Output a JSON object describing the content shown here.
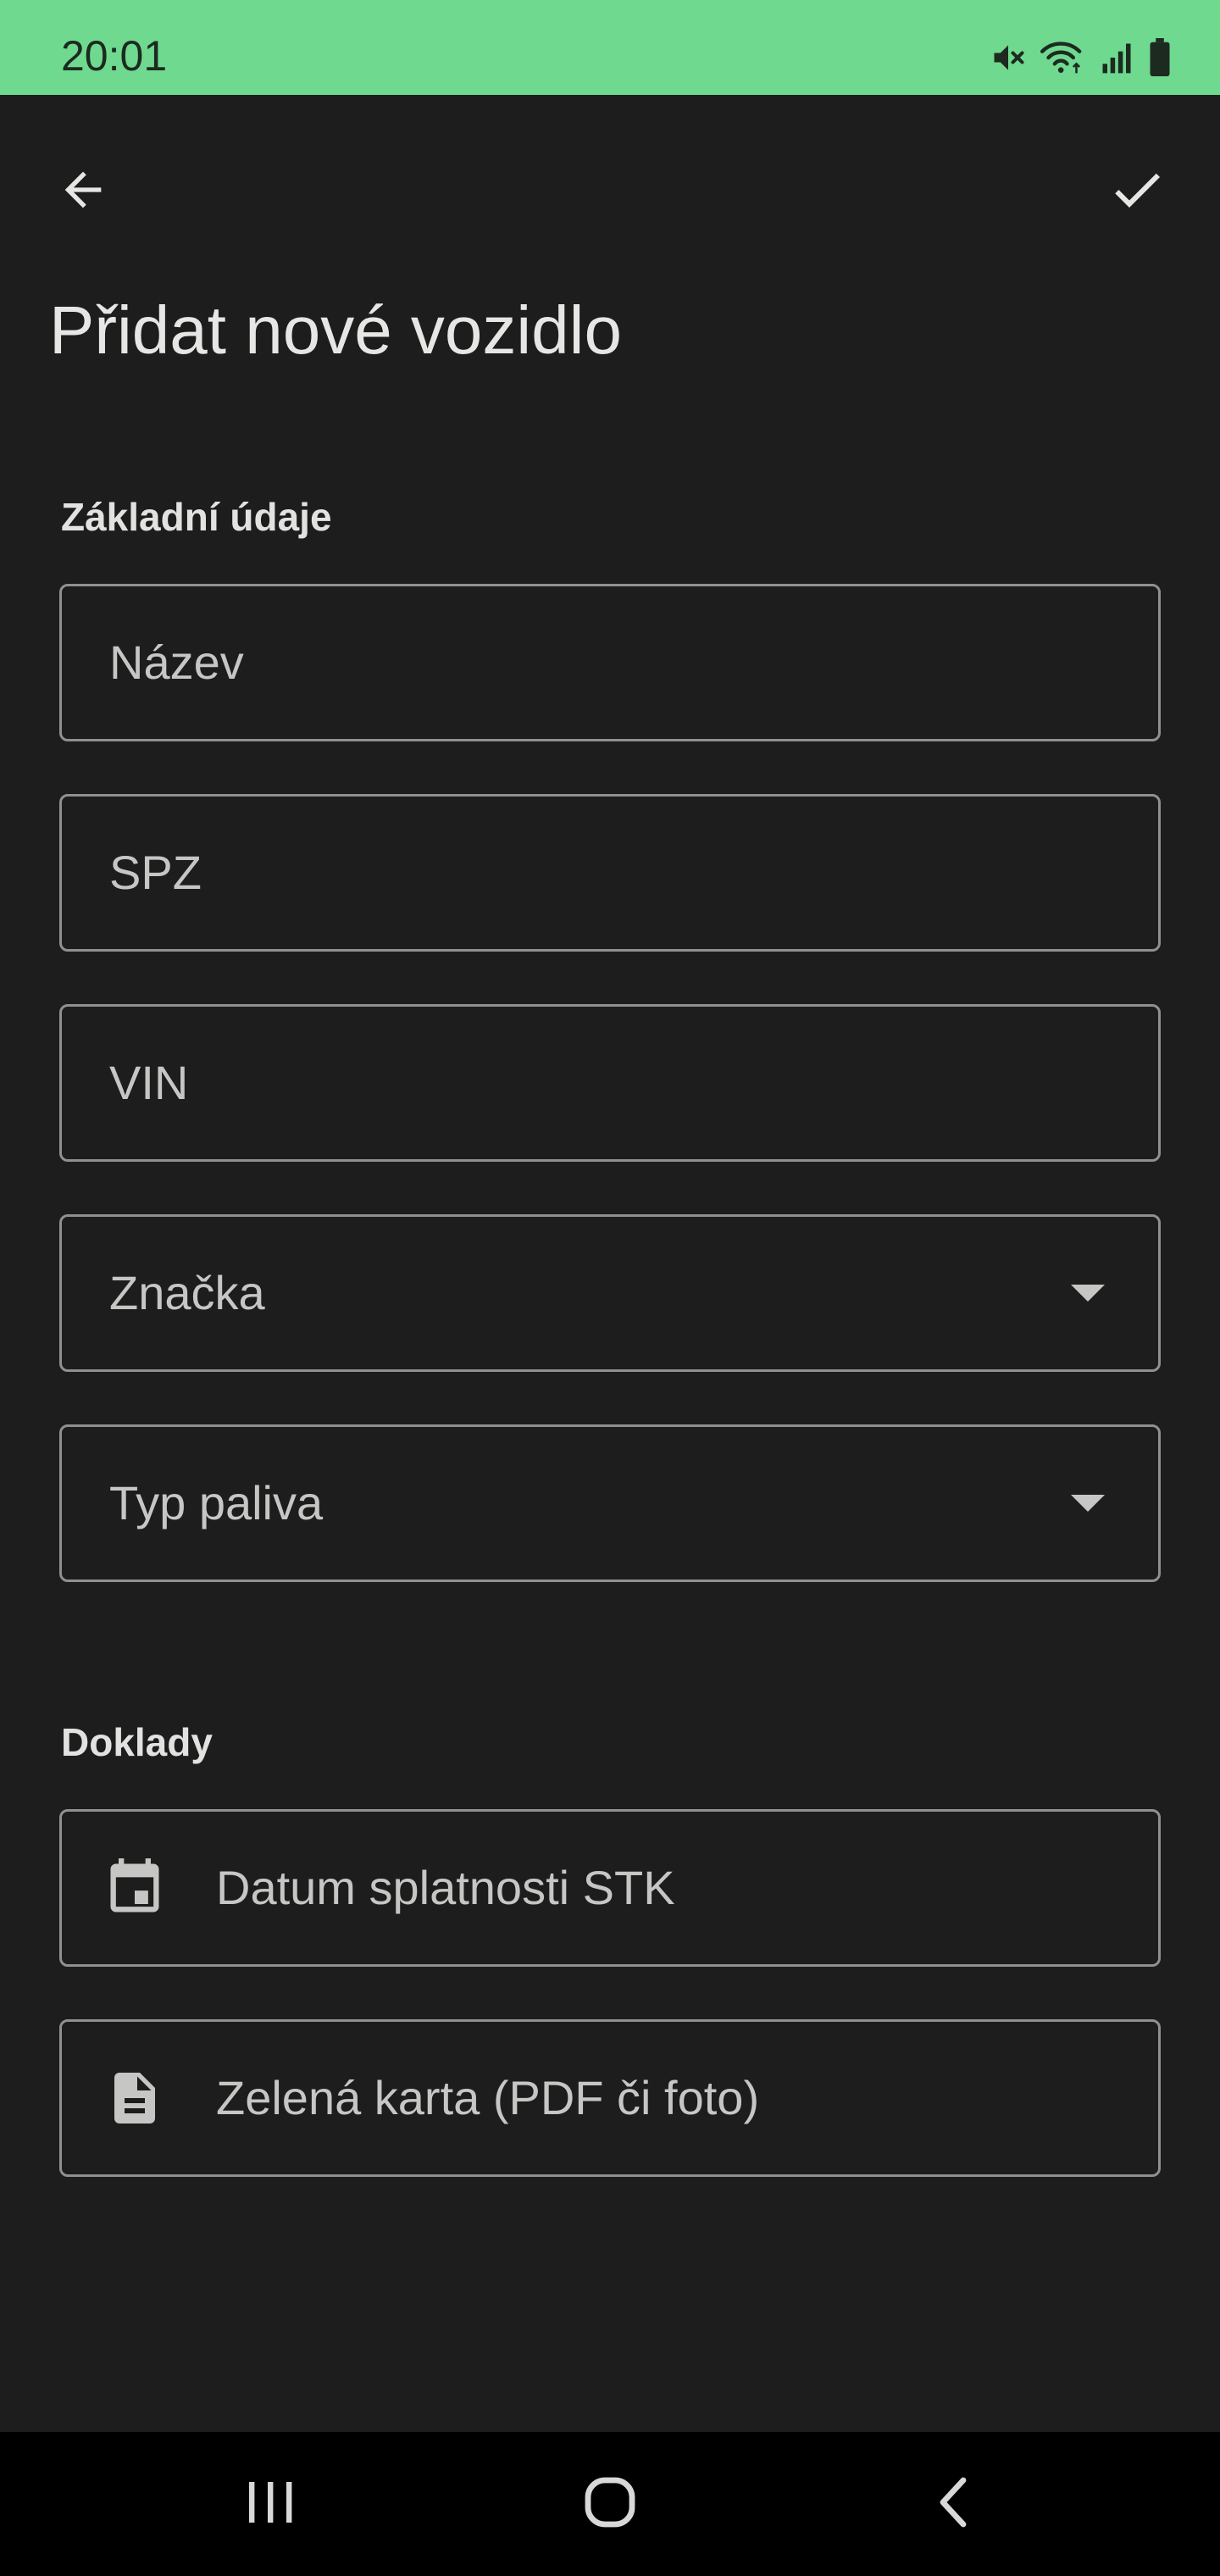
{
  "status_bar": {
    "time": "20:01",
    "icons": [
      "mute-icon",
      "wifi-icon",
      "signal-icon",
      "battery-icon"
    ],
    "background": "#6fd98f"
  },
  "app_bar": {
    "back_icon": "arrow-back-icon",
    "confirm_icon": "check-icon"
  },
  "page": {
    "title": "Přidat nové vozidlo"
  },
  "sections": {
    "basic": {
      "title": "Základní údaje",
      "fields": {
        "name": {
          "placeholder": "Název"
        },
        "plate": {
          "placeholder": "SPZ"
        },
        "vin": {
          "placeholder": "VIN"
        },
        "brand": {
          "placeholder": "Značka",
          "type": "dropdown"
        },
        "fuel": {
          "placeholder": "Typ paliva",
          "type": "dropdown"
        }
      }
    },
    "documents": {
      "title": "Doklady",
      "fields": {
        "inspection_date": {
          "placeholder": "Datum splatnosti STK",
          "icon": "calendar-icon"
        },
        "green_card": {
          "placeholder": "Zelená karta (PDF či foto)",
          "icon": "document-icon"
        }
      }
    }
  },
  "nav_bar": {
    "buttons": [
      "recent-apps-icon",
      "home-icon",
      "nav-back-icon"
    ]
  },
  "colors": {
    "background": "#1c1d1c",
    "field_border": "#8f918e",
    "text_primary": "#e6e6e4",
    "text_secondary": "#c6c7c4"
  }
}
